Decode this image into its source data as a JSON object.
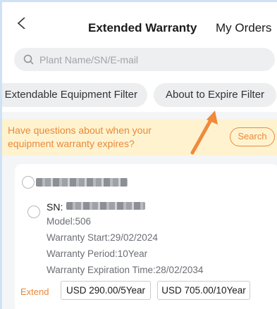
{
  "header": {
    "title": "Extended Warranty",
    "orders_label": "My Orders"
  },
  "search": {
    "placeholder": "Plant Name/SN/E-mail"
  },
  "filters": [
    {
      "label": "Extendable Equipment Filter"
    },
    {
      "label": "About to Expire Filter"
    }
  ],
  "banner": {
    "text": "Have questions about when your equipment warranty expires?",
    "button_label": "Search",
    "accent_color": "#e8893a"
  },
  "device": {
    "sn_label": "SN:",
    "model": "Model:506",
    "warranty_start": "Warranty Start:29/02/2024",
    "warranty_period": "Warranty Period:10Year",
    "warranty_expiration": "Warranty Expiration Time:28/02/2034",
    "extend_label": "Extend",
    "options": [
      {
        "label": "USD 290.00/5Year"
      },
      {
        "label": "USD 705.00/10Year"
      }
    ]
  },
  "icons": {
    "back": "chevron-left-icon",
    "search": "search-icon",
    "arrow": "annotation-arrow-icon"
  }
}
